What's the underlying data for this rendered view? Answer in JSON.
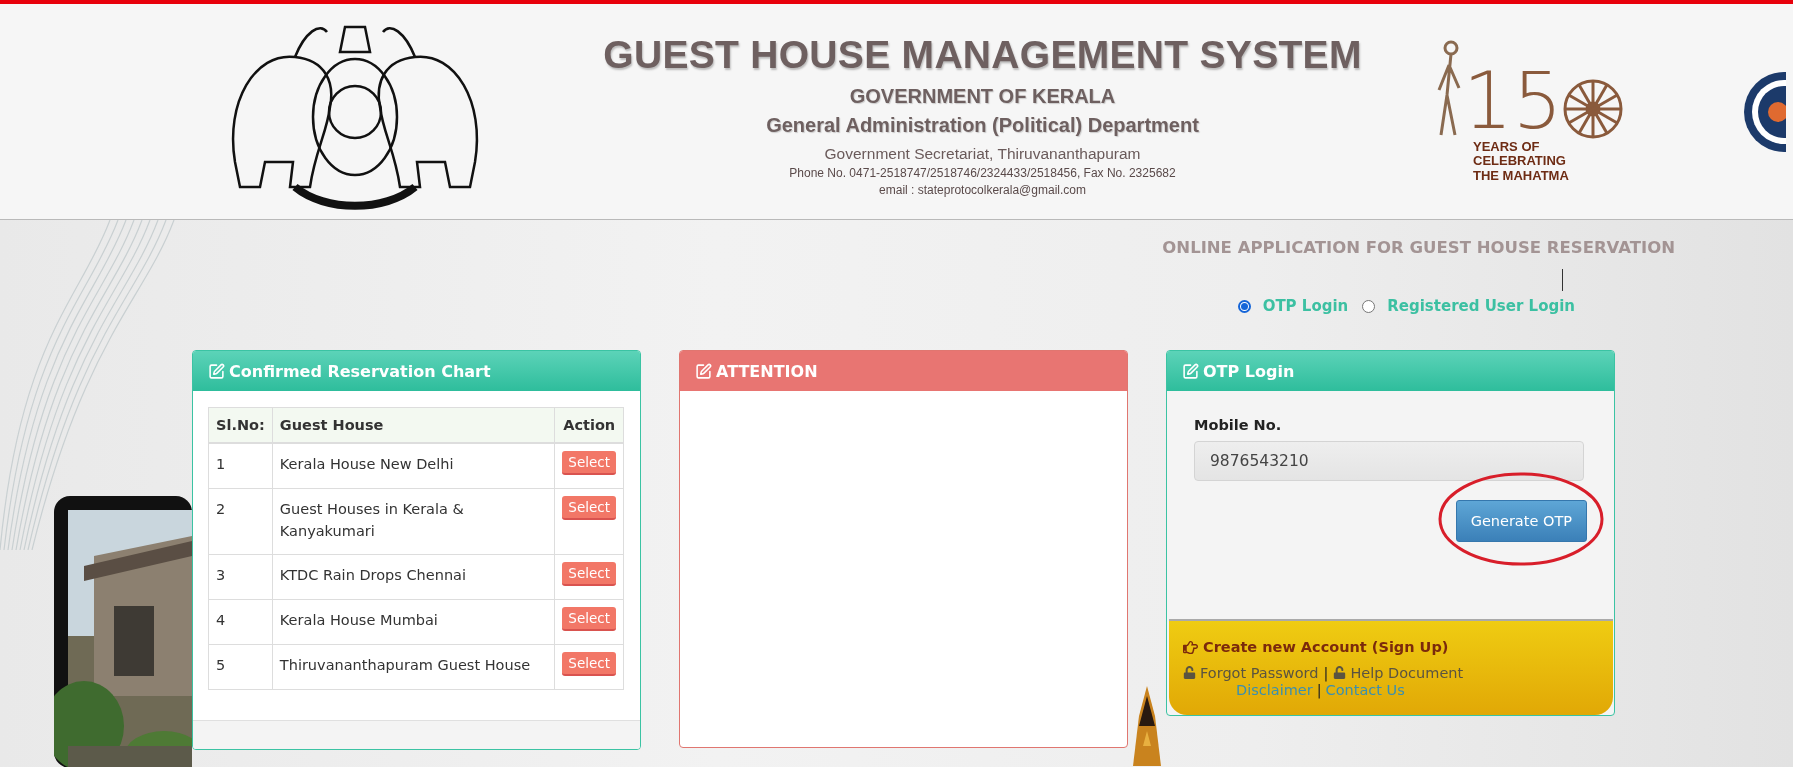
{
  "header": {
    "title": "GUEST HOUSE MANAGEMENT SYSTEM",
    "subtitle": "GOVERNMENT OF KERALA",
    "department": "General Administration (Political) Department",
    "office": "Government Secretariat, Thiruvananthapuram",
    "phone": "Phone No. 0471-2518747/2518746/2324433/2518456, Fax No. 2325682",
    "email": "email : stateprotocolkerala@gmail.com",
    "anniversary_logo": {
      "number": "15",
      "lines": [
        "YEARS OF",
        "CELEBRATING",
        "THE MAHATMA"
      ]
    }
  },
  "page_heading": "ONLINE APPLICATION FOR GUEST HOUSE RESERVATION",
  "login_options": [
    {
      "label": "OTP Login",
      "selected": true
    },
    {
      "label": "Registered User Login",
      "selected": false
    }
  ],
  "reservation_panel": {
    "title": "Confirmed Reservation Chart",
    "columns": [
      "Sl.No:",
      "Guest House",
      "Action"
    ],
    "rows": [
      {
        "sl": "1",
        "guest_house": "Kerala House New Delhi",
        "action": "Select"
      },
      {
        "sl": "2",
        "guest_house": "Guest Houses in Kerala & Kanyakumari",
        "action": "Select"
      },
      {
        "sl": "3",
        "guest_house": "KTDC Rain Drops Chennai",
        "action": "Select"
      },
      {
        "sl": "4",
        "guest_house": "Kerala House Mumbai",
        "action": "Select"
      },
      {
        "sl": "5",
        "guest_house": "Thiruvananthapuram Guest House",
        "action": "Select"
      }
    ]
  },
  "attention_panel": {
    "title": "ATTENTION"
  },
  "otp_panel": {
    "title": "OTP Login",
    "field": {
      "label": "Mobile No.",
      "value": "9876543210"
    },
    "button": {
      "label": "Generate OTP",
      "circled": true
    },
    "signup": "Create new Account (Sign Up)",
    "links": [
      "Forgot Password",
      "Help Document"
    ],
    "link_separator": "|",
    "footer_links": [
      "Disclaimer",
      "Contact Us"
    ],
    "footer_separator": "|"
  }
}
